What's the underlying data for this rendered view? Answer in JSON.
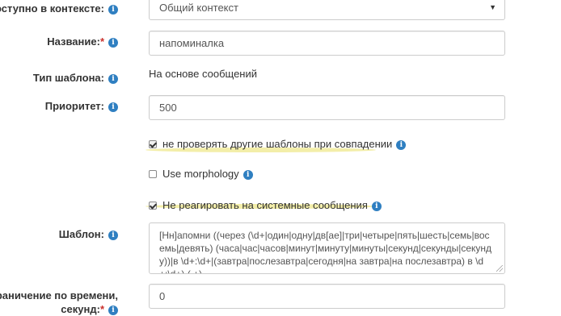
{
  "fields": {
    "context": {
      "label": "Доступно в контексте:",
      "value": "Общий контекст"
    },
    "name": {
      "label": "Название:",
      "required_mark": "*",
      "value": "напоминалка"
    },
    "template_type": {
      "label": "Тип шаблона:",
      "value": "На основе сообщений"
    },
    "priority": {
      "label": "Приоритет:",
      "value": "500"
    },
    "no_check_others": {
      "label": "не проверять другие шаблоны при совпадении",
      "checked": true
    },
    "use_morphology": {
      "label": "Use morphology",
      "checked": false
    },
    "ignore_system": {
      "label": "Не реагировать на системные сообщения",
      "checked": true
    },
    "template": {
      "label": "Шаблон:",
      "value": "[Нн]апомни ((через (\\d+|один|одну|дв[ае]|три|четыре|пять|шесть|семь|восемь|девять) (часа|час|часов|минут|минуту|минуты|секунд|секунды|секунду))|в \\d+:\\d+|(завтра|послезавтра|сегодня|на завтра|на послезавтра) в \\d+:\\d+) (.+)"
    },
    "time_limit": {
      "label": "Ограничение по времени,",
      "label_line2": "секунд:",
      "required_mark": "*",
      "value": "0"
    }
  },
  "icons": {
    "info": "info-icon",
    "checkbox_checked": "checkmark-icon",
    "select_arrow": "caret-down-icon"
  },
  "colors": {
    "info_icon": "#2f7fc1",
    "required": "#c9302c",
    "highlight": "#f1eb9a"
  }
}
